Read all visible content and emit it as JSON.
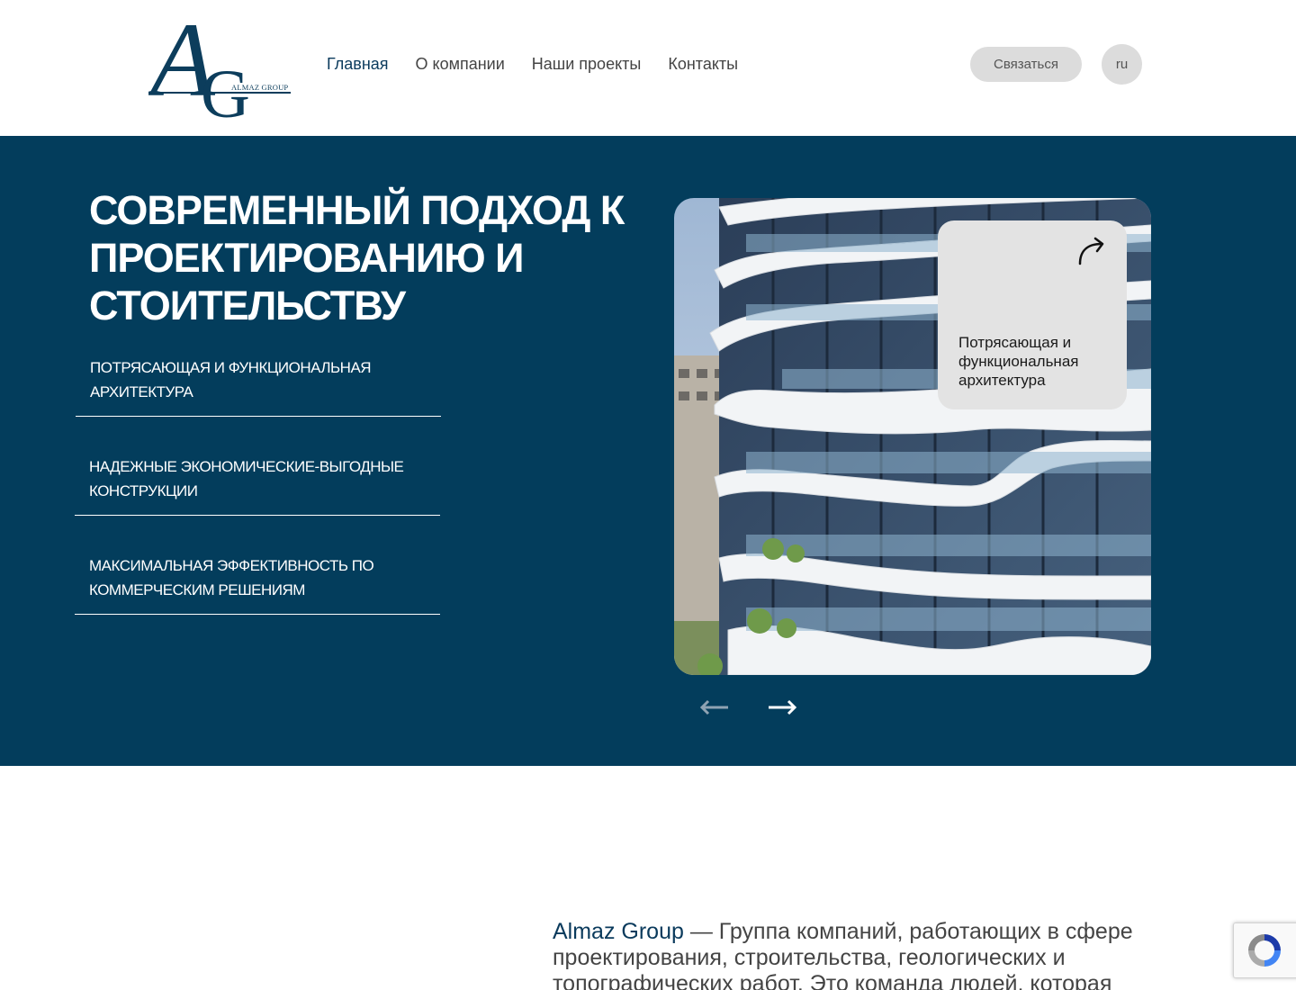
{
  "header": {
    "logo_letters": "AG",
    "logo_text": "ALMAZ GROUP",
    "nav": [
      {
        "label": "Главная",
        "active": true
      },
      {
        "label": "О компании",
        "active": false
      },
      {
        "label": "Наши проекты",
        "active": false
      },
      {
        "label": "Контакты",
        "active": false
      }
    ],
    "contact_button": "Связаться",
    "language": "ru"
  },
  "hero": {
    "title": "СОВРЕМЕННЫЙ ПОДХОД К ПРОЕКТИРОВАНИЮ И СТОИТЕЛЬСТВУ",
    "features": [
      "ПОТРЯСАЮЩАЯ И ФУНКЦИОНАЛЬНАЯ АРХИТЕКТУРА",
      "НАДЕЖНЫЕ ЭКОНОМИЧЕСКИЕ-ВЫГОДНЫЕ КОНСТРУКЦИИ",
      "МАКСИМАЛЬНАЯ ЭФФЕКТИВНОСТЬ ПО КОММЕРЧЕСКИМ РЕШЕНИЯМ"
    ],
    "slide": {
      "caption": "Потрясающая и функциональная архитектура",
      "icon": "curved-arrow-icon"
    },
    "slider_controls": {
      "prev_icon": "arrow-left-icon",
      "next_icon": "arrow-right-icon"
    },
    "background_color": "#033d5c"
  },
  "about": {
    "brand": "Almaz Group",
    "text": " — Группа компаний, работающих в сфере проектирования, строительства, геологических и топографических работ. Это команда людей, которая"
  },
  "colors": {
    "brand": "#0a3a5c",
    "hero_bg": "#033d5c",
    "button_bg": "#dcdcdc"
  }
}
